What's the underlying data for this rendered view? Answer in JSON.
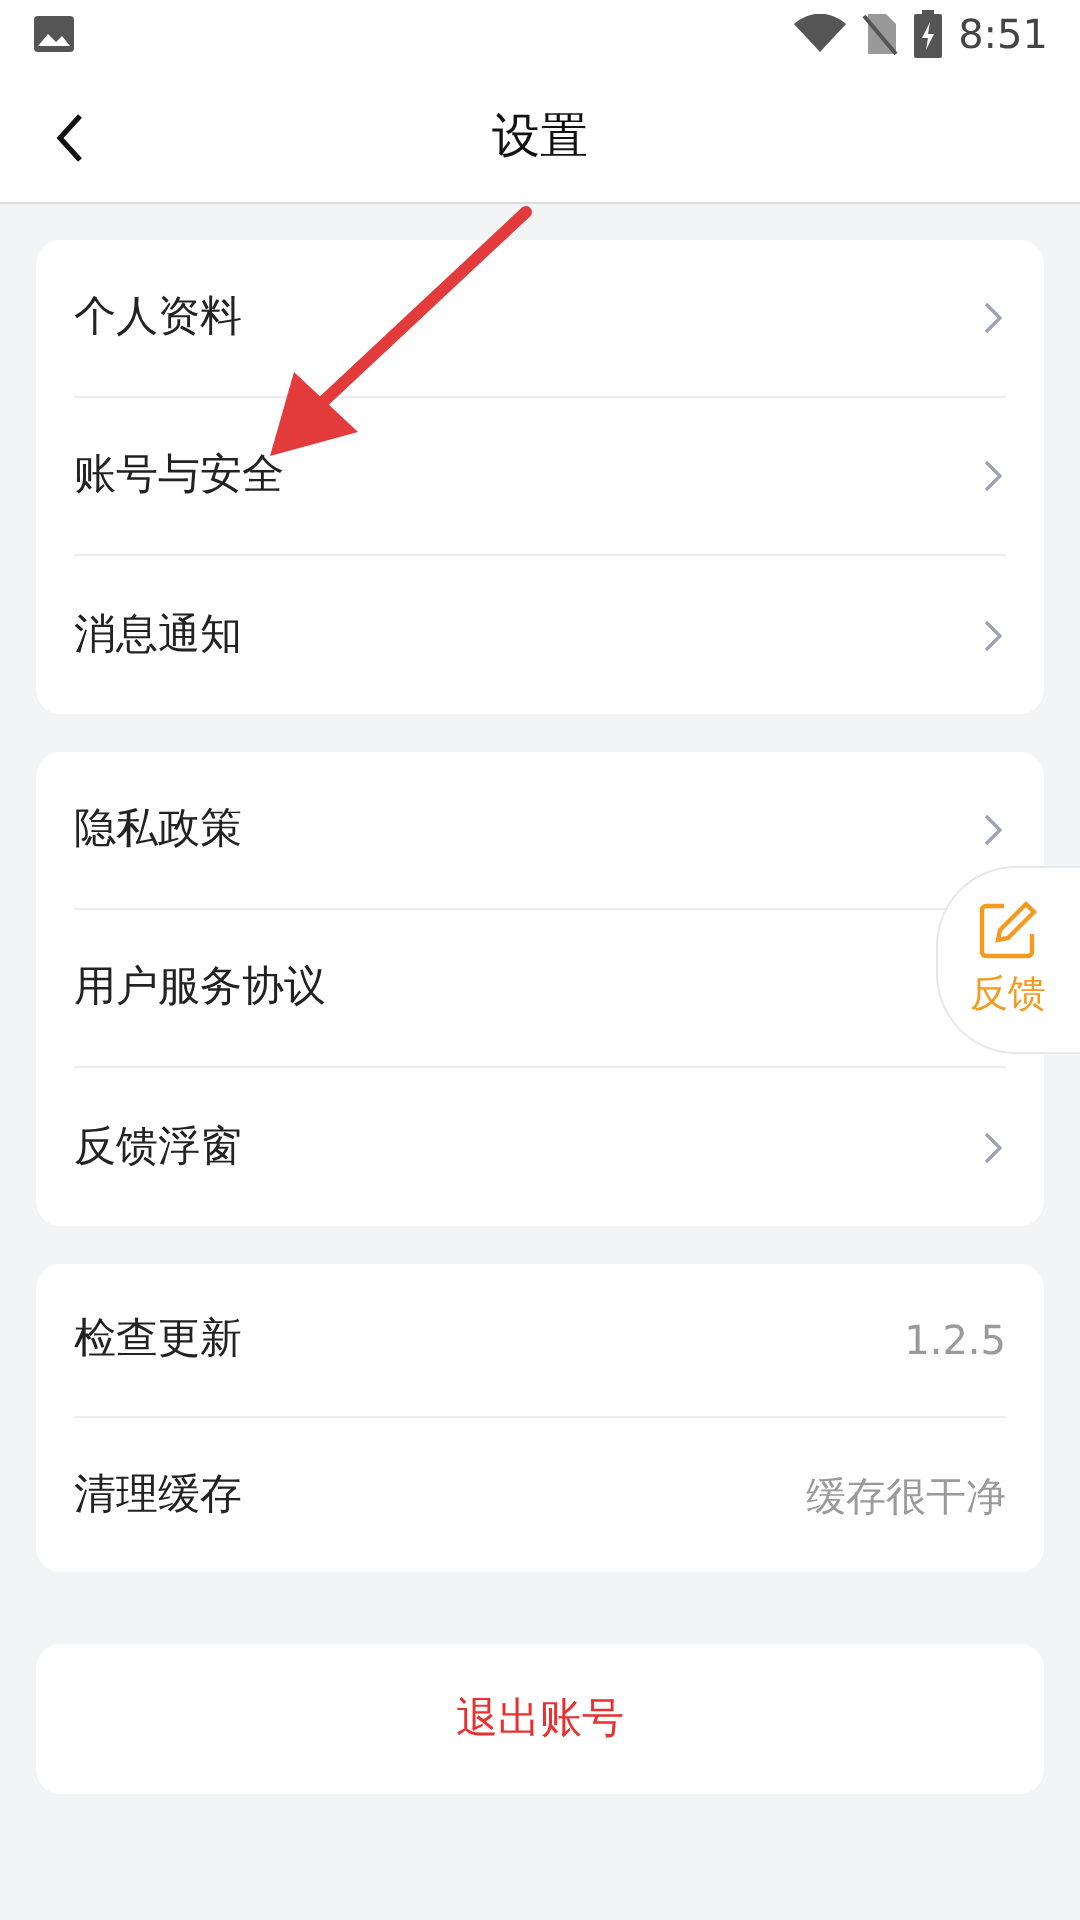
{
  "status_bar": {
    "time": "8:51"
  },
  "header": {
    "title": "设置"
  },
  "sections": [
    {
      "items": [
        {
          "label": "个人资料",
          "kind": "link"
        },
        {
          "label": "账号与安全",
          "kind": "link"
        },
        {
          "label": "消息通知",
          "kind": "link"
        }
      ]
    },
    {
      "items": [
        {
          "label": "隐私政策",
          "kind": "link"
        },
        {
          "label": "用户服务协议",
          "kind": "plain"
        },
        {
          "label": "反馈浮窗",
          "kind": "link"
        }
      ]
    },
    {
      "items": [
        {
          "label": "检查更新",
          "kind": "value",
          "value": "1.2.5"
        },
        {
          "label": "清理缓存",
          "kind": "value",
          "value": "缓存很干净"
        }
      ]
    }
  ],
  "logout": {
    "label": "退出账号"
  },
  "feedback_bubble": {
    "label": "反馈"
  }
}
